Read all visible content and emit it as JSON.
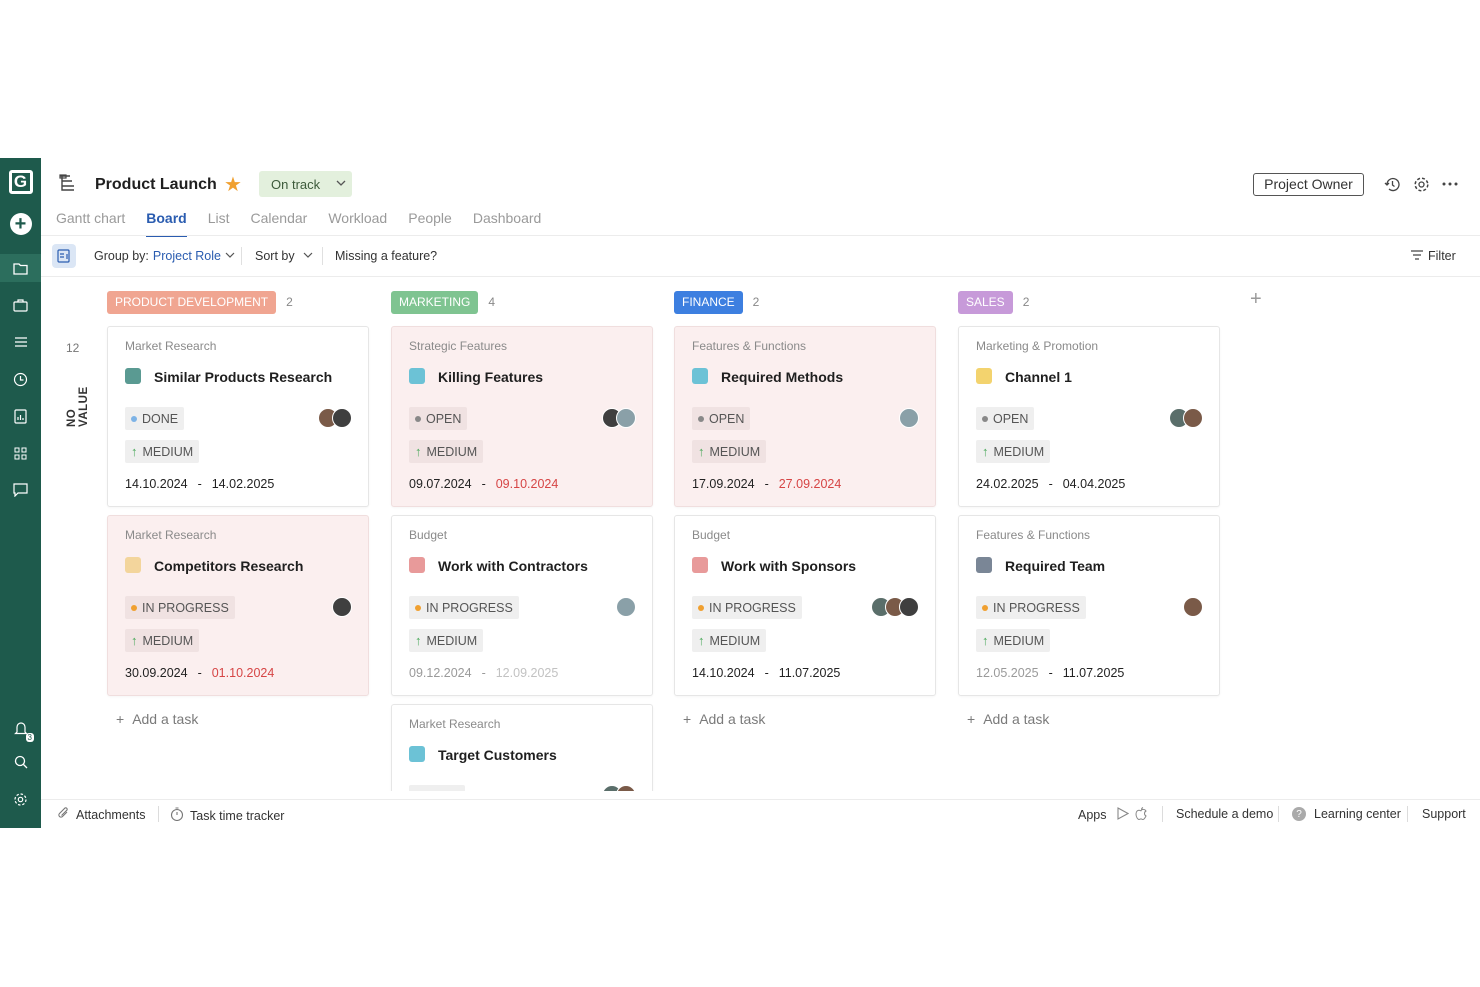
{
  "project": {
    "title": "Product Launch",
    "status": "On track",
    "owner_role": "Project Owner"
  },
  "tabs": [
    "Gantt chart",
    "Board",
    "List",
    "Calendar",
    "Workload",
    "People",
    "Dashboard"
  ],
  "active_tab": "Board",
  "toolbar": {
    "group_by_label": "Group by:",
    "group_by_value": "Project Role",
    "sort_by": "Sort by",
    "missing_feature": "Missing a feature?",
    "filter": "Filter"
  },
  "group": {
    "count": "12",
    "label": "NO VALUE"
  },
  "columns": [
    {
      "name": "PRODUCT DEVELOPMENT",
      "count": "2",
      "color": "#f0a591",
      "cards": [
        {
          "category": "Market Research",
          "name": "Similar Products Research",
          "square": "#5a9a92",
          "status": "DONE",
          "status_dot": "#7db3e6",
          "priority": "MEDIUM",
          "start": "14.10.2024",
          "end": "14.02.2025",
          "overdue": false,
          "avatars": 2
        },
        {
          "category": "Market Research",
          "name": "Competitors Research",
          "square": "#f3d59c",
          "status": "IN PROGRESS",
          "status_dot": "#f0a030",
          "priority": "MEDIUM",
          "start": "30.09.2024",
          "end": "01.10.2024",
          "overdue": true,
          "avatars": 1
        }
      ],
      "add_task": "Add a task"
    },
    {
      "name": "MARKETING",
      "count": "4",
      "color": "#7fc491",
      "cards": [
        {
          "category": "Strategic Features",
          "name": "Killing Features",
          "square": "#6cc2d6",
          "status": "OPEN",
          "status_dot": "#888888",
          "priority": "MEDIUM",
          "start": "09.07.2024",
          "end": "09.10.2024",
          "overdue": true,
          "avatars": 2
        },
        {
          "category": "Budget",
          "name": "Work with Contractors",
          "square": "#e89a9a",
          "status": "IN PROGRESS",
          "status_dot": "#f0a030",
          "priority": "MEDIUM",
          "start": "09.12.2024",
          "end": "12.09.2025",
          "overdue": false,
          "faded": true,
          "avatars": 1
        },
        {
          "category": "Market Research",
          "name": "Target Customers",
          "square": "#6cc2d6",
          "status": "",
          "status_dot": "#888888",
          "priority": "",
          "start": "",
          "end": "",
          "overdue": false,
          "avatars": 2
        }
      ],
      "add_task": ""
    },
    {
      "name": "FINANCE",
      "count": "2",
      "color": "#3d7fe0",
      "cards": [
        {
          "category": "Features & Functions",
          "name": "Required Methods",
          "square": "#6cc2d6",
          "status": "OPEN",
          "status_dot": "#888888",
          "priority": "MEDIUM",
          "start": "17.09.2024",
          "end": "27.09.2024",
          "overdue": true,
          "avatars": 1
        },
        {
          "category": "Budget",
          "name": "Work with Sponsors",
          "square": "#e89a9a",
          "status": "IN PROGRESS",
          "status_dot": "#f0a030",
          "priority": "MEDIUM",
          "start": "14.10.2024",
          "end": "11.07.2025",
          "overdue": false,
          "avatars": 3
        }
      ],
      "add_task": "Add a task"
    },
    {
      "name": "SALES",
      "count": "2",
      "color": "#c79ad9",
      "cards": [
        {
          "category": "Marketing & Promotion",
          "name": "Channel 1",
          "square": "#f3d36e",
          "status": "OPEN",
          "status_dot": "#888888",
          "priority": "MEDIUM",
          "start": "24.02.2025",
          "end": "04.04.2025",
          "overdue": false,
          "avatars": 2
        },
        {
          "category": "Features & Functions",
          "name": "Required Team",
          "square": "#7a8696",
          "status": "IN PROGRESS",
          "status_dot": "#f0a030",
          "priority": "MEDIUM",
          "start": "12.05.2025",
          "end": "11.07.2025",
          "overdue": false,
          "start_faded": true,
          "avatars": 1
        }
      ],
      "add_task": "Add a task"
    }
  ],
  "footer": {
    "attachments": "Attachments",
    "time_tracker": "Task time tracker",
    "apps": "Apps",
    "schedule_demo": "Schedule a demo",
    "learning_center": "Learning center",
    "support": "Support"
  },
  "notifications_count": "3"
}
